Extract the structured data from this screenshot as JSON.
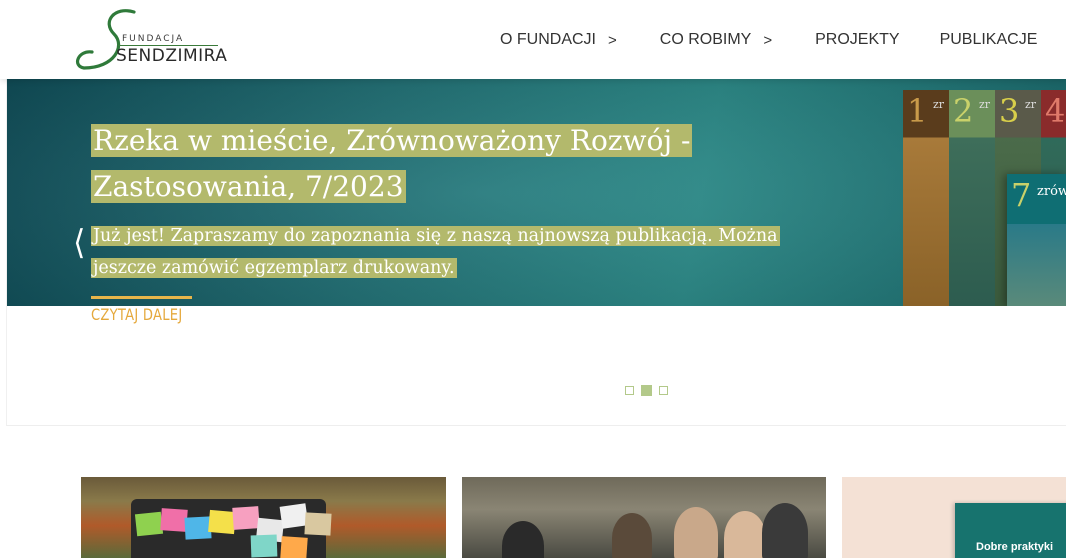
{
  "header": {
    "logo": {
      "small_text": "FUNDACJA",
      "big_text": "SENDZIMIRA",
      "accent_color": "#2f7a3a"
    },
    "nav": [
      {
        "label": "O FUNDACJI",
        "has_submenu": true,
        "arrow": ">"
      },
      {
        "label": "CO ROBIMY",
        "has_submenu": true,
        "arrow": ">"
      },
      {
        "label": "PROJEKTY",
        "has_submenu": false
      },
      {
        "label": "PUBLIKACJE",
        "has_submenu": false
      }
    ]
  },
  "slider": {
    "prev_icon": "chevron-left-icon",
    "prev_glyph": "❬",
    "slide": {
      "title": "Rzeka w mieście, Zrównoważony Rozwój - Zastosowania, 7/2023",
      "description": "Już jest! Zapraszamy do zapoznania się z naszą najnowszą publikacją. Można jeszcze zamówić egzemplarz drukowany.",
      "read_more": "CZYTAJ DALEJ",
      "book_numbers": [
        "1",
        "2",
        "3",
        "4",
        "7"
      ],
      "book_spine_text": "zr",
      "book7_text": "zrów"
    },
    "pagination": {
      "total": 3,
      "active_index": 1
    },
    "colors": {
      "highlight": "#b3b96c",
      "read_more": "#e5a93d",
      "dot": "#b3c98a"
    }
  },
  "cards": [
    {
      "name": "card-sticky-notes"
    },
    {
      "name": "card-people-group"
    },
    {
      "name": "card-publication",
      "text": "Dobre praktyki"
    }
  ]
}
